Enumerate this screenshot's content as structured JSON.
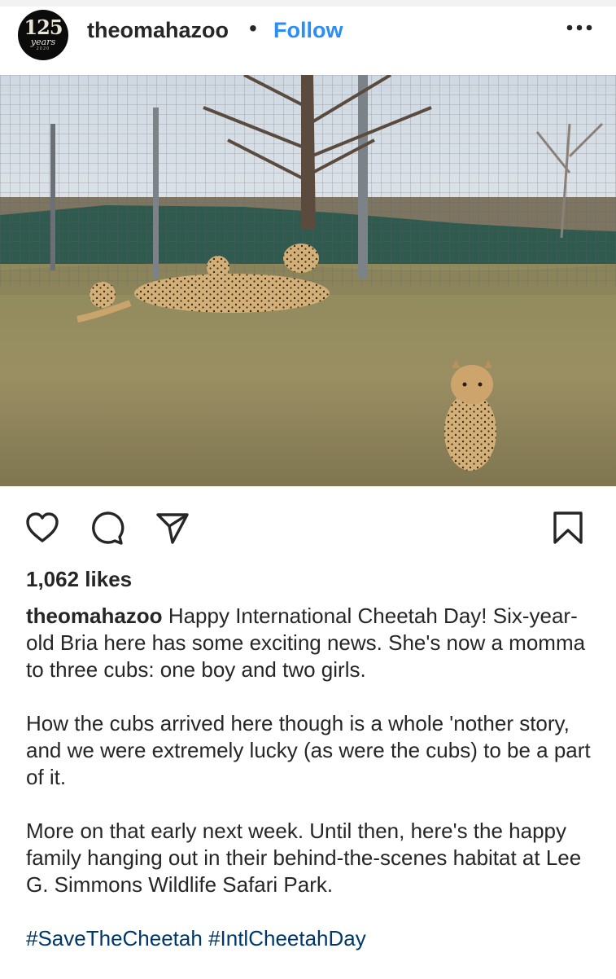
{
  "post": {
    "username": "theomahazoo",
    "separator": "•",
    "follow_label": "Follow",
    "avatar": {
      "number": "125",
      "script": "years",
      "year": "2020"
    },
    "likes": "1,062 likes",
    "caption": {
      "p1": "Happy International Cheetah Day! Six-year-old Bria here has some exciting news. She's now a momma to three cubs: one boy and two girls.",
      "p2": "How the cubs arrived here though is a whole 'nother story, and we were extremely lucky (as were the cubs) to be a part of it.",
      "p3": "More on that early next week. Until then, here's the happy family hanging out in their behind-the-scenes habitat at Lee G. Simmons Wildlife Safari Park."
    },
    "hashtags": [
      "#SaveTheCheetah",
      "#IntlCheetahDay"
    ]
  },
  "icons": {
    "more": "more-options-icon",
    "like": "heart-icon",
    "comment": "comment-bubble-icon",
    "share": "paper-plane-icon",
    "save": "bookmark-icon"
  },
  "colors": {
    "text": "#262626",
    "follow": "#2a8ef5",
    "hashtag": "#00376b"
  }
}
